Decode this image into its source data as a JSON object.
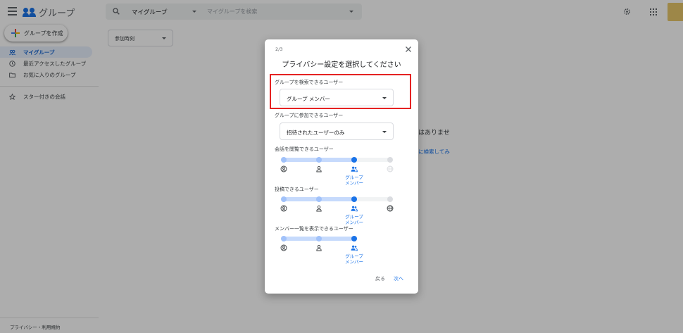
{
  "app": {
    "name": "グループ",
    "search_scope": "マイグループ",
    "search_placeholder": "マイグループを検索",
    "create_button": "グループを作成",
    "nav": [
      {
        "label": "マイグループ",
        "active": true,
        "icon": "groups-icon"
      },
      {
        "label": "最近アクセスしたグループ",
        "active": false,
        "icon": "clock-icon"
      },
      {
        "label": "お気に入りのグループ",
        "active": false,
        "icon": "folder-icon"
      }
    ],
    "starred": {
      "label": "スター付きの会話",
      "icon": "star-icon"
    },
    "footer": "プライバシー・利用規約",
    "filter": "参加時刻",
    "empty_message": "はありませ",
    "empty_link": "に検索してみ"
  },
  "dialog": {
    "step": "2/3",
    "title": "プライバシー設定を選択してください",
    "search_field": {
      "label": "グループを検索できるユーザー",
      "value": "グループ メンバー"
    },
    "join_field": {
      "label": "グループに参加できるユーザー",
      "value": "招待されたユーザーのみ"
    },
    "view_conversations": {
      "label": "会話を閲覧できるユーザー",
      "selected_label": "グループ メンバー",
      "selected_index": 2,
      "options": [
        "account-circle-icon",
        "person-icon",
        "group-icon",
        "globe-icon"
      ],
      "last_enabled": false
    },
    "post": {
      "label": "投稿できるユーザー",
      "selected_label": "グループ メンバー",
      "selected_index": 2,
      "options": [
        "account-circle-icon",
        "person-icon",
        "group-icon",
        "globe-icon"
      ],
      "last_enabled": true
    },
    "view_members": {
      "label": "メンバー一覧を表示できるユーザー",
      "selected_label": "グループ メンバー",
      "selected_index": 2,
      "options": [
        "account-circle-icon",
        "person-icon",
        "group-icon"
      ]
    },
    "back_button": "戻る",
    "next_button": "次へ"
  },
  "colors": {
    "accent": "#1a73e8",
    "highlight": "#e52222",
    "scrim": "rgba(0,0,0,0.32)"
  }
}
